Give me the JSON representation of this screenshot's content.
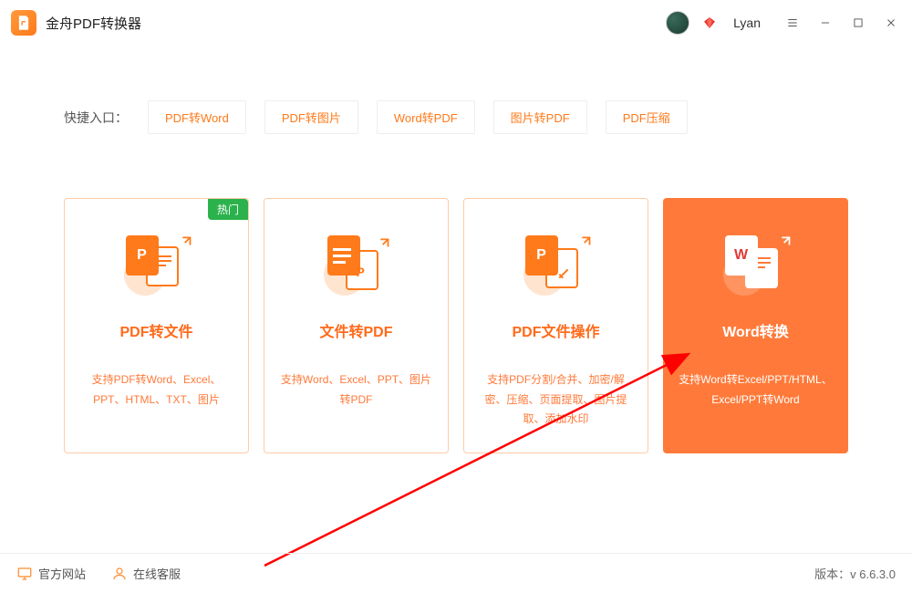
{
  "app": {
    "title": "金舟PDF转换器",
    "username": "Lyan"
  },
  "quick": {
    "label": "快捷入口：",
    "items": [
      "PDF转Word",
      "PDF转图片",
      "Word转PDF",
      "图片转PDF",
      "PDF压缩"
    ]
  },
  "cards": [
    {
      "title": "PDF转文件",
      "desc": "支持PDF转Word、Excel、PPT、HTML、TXT、图片",
      "hot": "热门"
    },
    {
      "title": "文件转PDF",
      "desc": "支持Word、Excel、PPT、图片转PDF"
    },
    {
      "title": "PDF文件操作",
      "desc": "支持PDF分割/合并、加密/解密、压缩、页面提取、图片提取、添加水印"
    },
    {
      "title": "Word转换",
      "desc": "支持Word转Excel/PPT/HTML、Excel/PPT转Word"
    }
  ],
  "footer": {
    "site": "官方网站",
    "support": "在线客服",
    "version_label": "版本：",
    "version": "v 6.6.3.0"
  }
}
